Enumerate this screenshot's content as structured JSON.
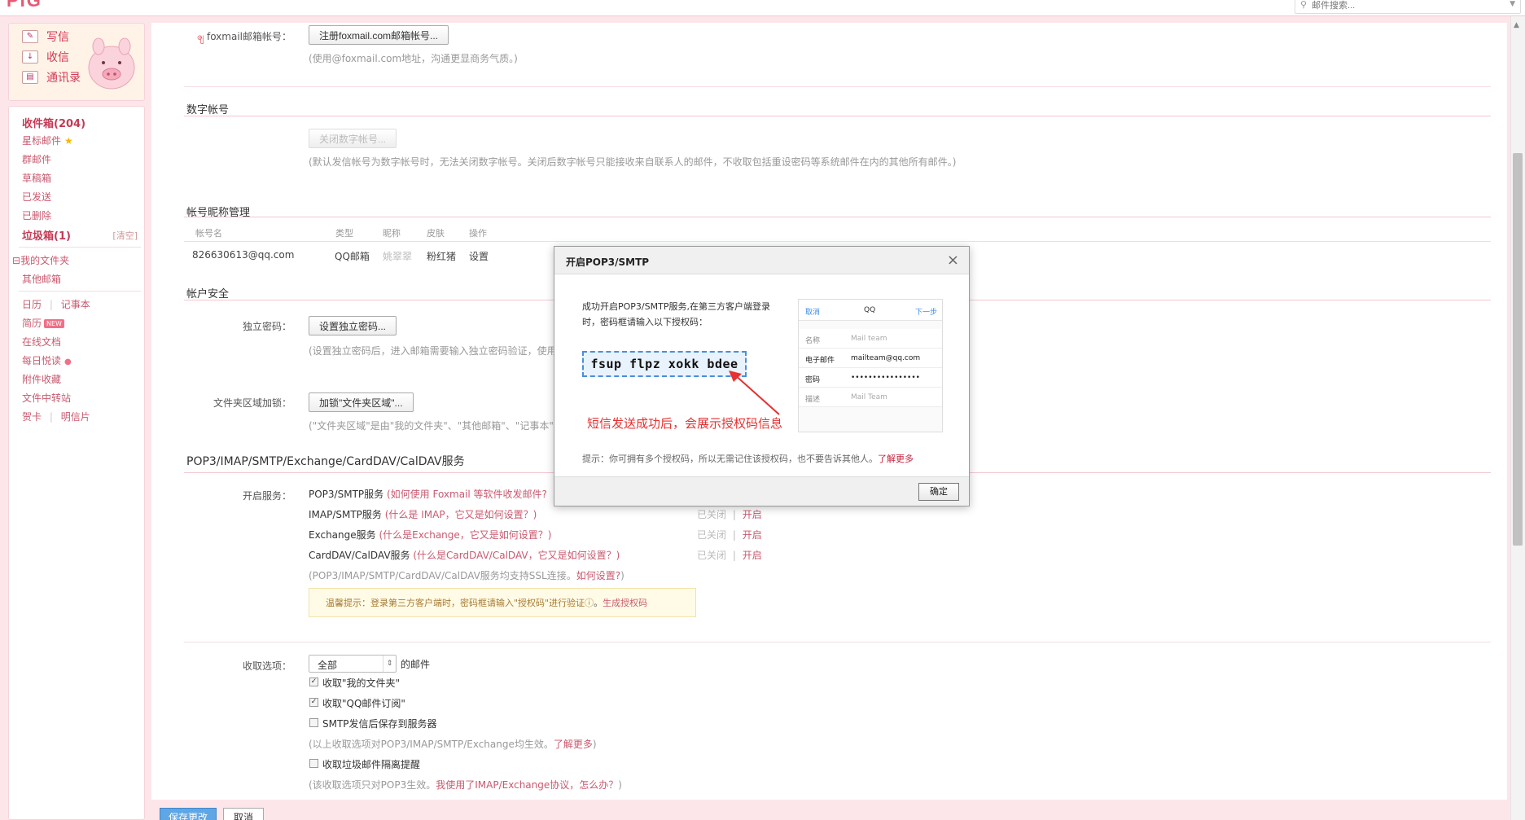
{
  "search": {
    "placeholder": "邮件搜索..."
  },
  "quick": {
    "compose": "写信",
    "inbox": "收信",
    "contacts": "通讯录"
  },
  "folders": {
    "inbox": "收件箱(204)",
    "starred": "星标邮件",
    "group": "群邮件",
    "drafts": "草稿箱",
    "sent": "已发送",
    "deleted": "已删除",
    "spam": "垃圾箱(1)",
    "spam_clear": "[清空]",
    "my_folders": "我的文件夹",
    "other_mail": "其他邮箱",
    "calendar": "日历",
    "notes": "记事本",
    "resume": "简历",
    "resume_badge": "NEW",
    "docs": "在线文档",
    "daily": "每日悦读",
    "attachments": "附件收藏",
    "transfer": "文件中转站",
    "cards": "贺卡",
    "postcard": "明信片",
    "sep": "|"
  },
  "foxmail": {
    "label": "foxmail邮箱帐号：",
    "button": "注册foxmail.com邮箱帐号...",
    "hint": "(使用@foxmail.com地址，沟通更显商务气质。)"
  },
  "digital": {
    "title": "数字帐号",
    "button": "关闭数字帐号...",
    "hint": "(默认发信帐号为数字帐号时，无法关闭数字帐号。关闭后数字帐号只能接收来自联系人的邮件，不收取包括重设密码等系统邮件在内的其他所有邮件。)"
  },
  "nickname": {
    "title": "帐号昵称管理",
    "headers": [
      "帐号名",
      "类型",
      "昵称",
      "皮肤",
      "操作"
    ],
    "row": {
      "account": "826630613@qq.com",
      "type": "QQ邮箱",
      "nick": "姚翠翠",
      "skin": "粉红猪",
      "action": "设置"
    }
  },
  "security": {
    "title": "帐户安全",
    "pwd_label": "独立密码：",
    "pwd_button": "设置独立密码...",
    "pwd_hint": "(设置独立密码后，进入邮箱需要输入独立密码验证，使用",
    "folder_label": "文件夹区域加锁：",
    "folder_button": "加锁\"文件夹区域\"...",
    "folder_hint": "(\"文件夹区域\"是由\"我的文件夹\"、\"其他邮箱\"、\"记事本\""
  },
  "services": {
    "title": "POP3/IMAP/SMTP/Exchange/CardDAV/CalDAV服务",
    "open_label": "开启服务：",
    "items": [
      {
        "name": "POP3/SMTP服务",
        "help": "(如何使用 Foxmail 等软件收发邮件?",
        "status": "",
        "action": ""
      },
      {
        "name": "IMAP/SMTP服务",
        "help": "(什么是 IMAP，它又是如何设置？)",
        "status": "已关闭",
        "action": "开启"
      },
      {
        "name": "Exchange服务",
        "help": "(什么是Exchange，它又是如何设置？)",
        "status": "已关闭",
        "action": "开启"
      },
      {
        "name": "CardDAV/CalDAV服务",
        "help": "(什么是CardDAV/CalDAV，它又是如何设置？)",
        "status": "已关闭",
        "action": "开启"
      }
    ],
    "ssl_hint": "(POP3/IMAP/SMTP/CardDAV/CalDAV服务均支持SSL连接。",
    "ssl_link": "如何设置?",
    "ssl_close": ")",
    "tip_text": "温馨提示：登录第三方客户端时，密码框请输入\"授权码\"进行验证",
    "tip_link": "生成授权码",
    "sep": "|"
  },
  "receive": {
    "label": "收取选项：",
    "select_value": "全部",
    "suffix": "的邮件",
    "options": [
      {
        "text": "收取\"我的文件夹\"",
        "checked": true
      },
      {
        "text": "收取\"QQ邮件订阅\"",
        "checked": true
      },
      {
        "text": "SMTP发信后保存到服务器",
        "checked": false
      }
    ],
    "hint1": "(以上收取选项对POP3/IMAP/SMTP/Exchange均生效。",
    "hint1_link": "了解更多",
    "hint1_close": ")",
    "spam_opt": "收取垃圾邮件隔离提醒",
    "hint2": "(该收取选项只对POP3生效。",
    "hint2_link": "我使用了IMAP/Exchange协议，怎么办？",
    "hint2_close": ")"
  },
  "actions": {
    "save": "保存更改",
    "cancel": "取消"
  },
  "modal": {
    "title": "开启POP3/SMTP",
    "message": "成功开启POP3/SMTP服务,在第三方客户端登录时，密码框请输入以下授权码：",
    "code": "fsup flpz xokk bdee",
    "annotation": "短信发送成功后，会展示授权码信息",
    "phone": {
      "cancel": "取消",
      "title": "QQ",
      "next": "下一步",
      "rows": [
        {
          "k": "名称",
          "v": "Mail team"
        },
        {
          "k": "电子邮件",
          "v": "mailteam@qq.com"
        },
        {
          "k": "密码",
          "v": "••••••••••••••••"
        },
        {
          "k": "描述",
          "v": "Mail Team"
        }
      ]
    },
    "tip": "提示：你可拥有多个授权码，所以无需记住该授权码，也不要告诉其他人。",
    "tip_link": "了解更多",
    "ok": "确定"
  }
}
